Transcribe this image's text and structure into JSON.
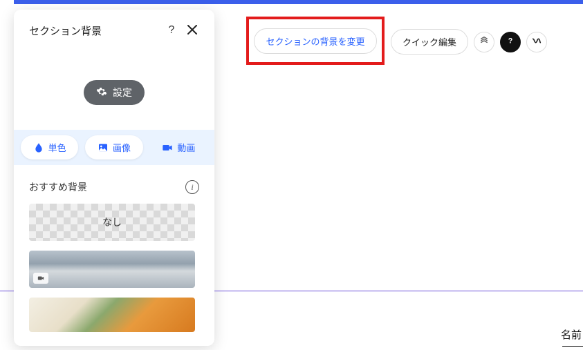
{
  "panel": {
    "title": "セクション背景",
    "help_label": "?",
    "settings_label": "設定",
    "tabs": {
      "solid": "単色",
      "image": "画像",
      "video": "動画"
    },
    "suggested_label": "おすすめ背景",
    "none_label": "なし"
  },
  "callout": {
    "change_bg_label": "セクションの背景を変更"
  },
  "right_controls": {
    "quick_edit_label": "クイック編集",
    "help_tooltip": "?"
  },
  "footer": {
    "name_label": "名前"
  },
  "colors": {
    "accent": "#3b5feb",
    "highlight_border": "#e31b1b",
    "link": "#2962ff"
  }
}
